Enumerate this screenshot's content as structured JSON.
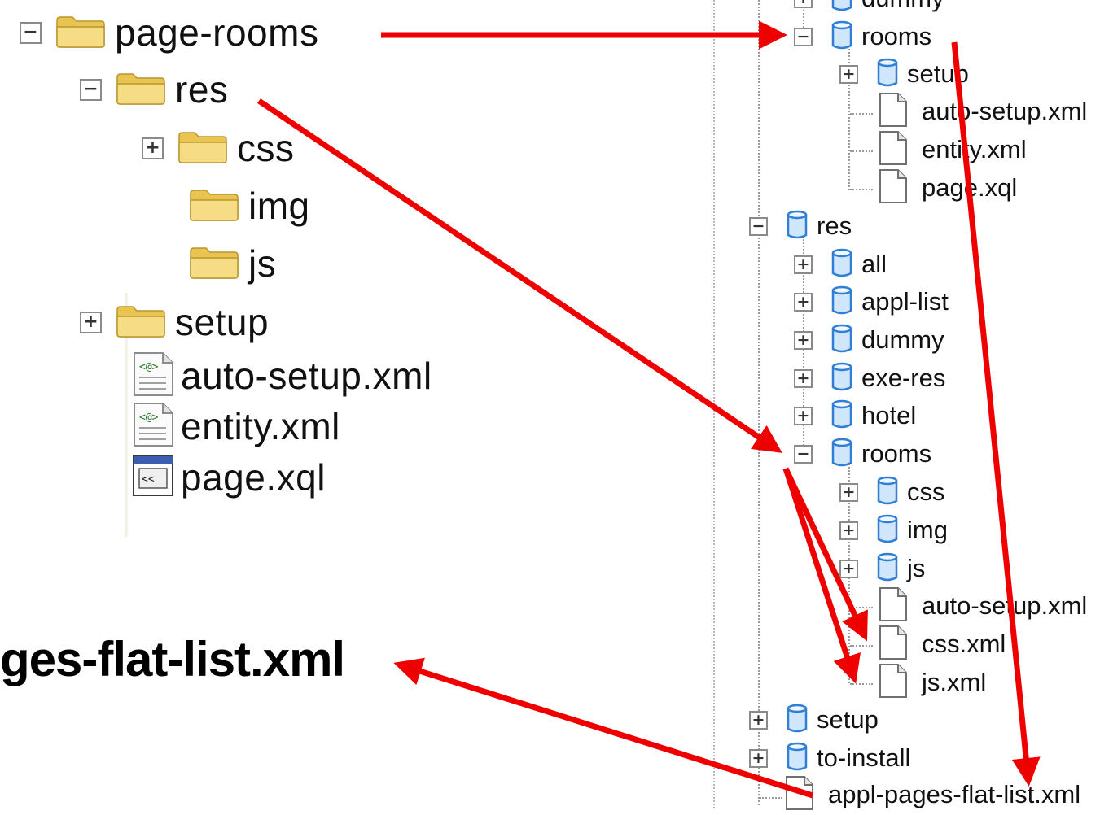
{
  "left_tree": {
    "items": [
      {
        "label": "page-rooms",
        "icon": "folder-icon",
        "expander": "minus"
      },
      {
        "label": "res",
        "icon": "folder-icon",
        "expander": "minus"
      },
      {
        "label": "css",
        "icon": "folder-icon",
        "expander": "plus"
      },
      {
        "label": "img",
        "icon": "folder-icon",
        "expander": ""
      },
      {
        "label": "js",
        "icon": "folder-icon",
        "expander": ""
      },
      {
        "label": "setup",
        "icon": "folder-icon",
        "expander": "plus"
      },
      {
        "label": "auto-setup.xml",
        "icon": "xml-file-icon",
        "expander": ""
      },
      {
        "label": "entity.xml",
        "icon": "xml-file-icon",
        "expander": ""
      },
      {
        "label": "page.xql",
        "icon": "xql-file-icon",
        "expander": ""
      }
    ]
  },
  "big_label": "ges-flat-list.xml",
  "right_tree": {
    "items": [
      {
        "label": "dummy",
        "icon": "collection-icon",
        "expander": "plus"
      },
      {
        "label": "rooms",
        "icon": "collection-icon",
        "expander": "minus"
      },
      {
        "label": "setup",
        "icon": "collection-icon",
        "expander": "plus"
      },
      {
        "label": "auto-setup.xml",
        "icon": "document-icon",
        "expander": ""
      },
      {
        "label": "entity.xml",
        "icon": "document-icon",
        "expander": ""
      },
      {
        "label": "page.xql",
        "icon": "document-icon",
        "expander": ""
      },
      {
        "label": "res",
        "icon": "collection-icon",
        "expander": "minus"
      },
      {
        "label": "all",
        "icon": "collection-icon",
        "expander": "plus"
      },
      {
        "label": "appl-list",
        "icon": "collection-icon",
        "expander": "plus"
      },
      {
        "label": "dummy",
        "icon": "collection-icon",
        "expander": "plus"
      },
      {
        "label": "exe-res",
        "icon": "collection-icon",
        "expander": "plus"
      },
      {
        "label": "hotel",
        "icon": "collection-icon",
        "expander": "plus"
      },
      {
        "label": "rooms",
        "icon": "collection-icon",
        "expander": "minus"
      },
      {
        "label": "css",
        "icon": "collection-icon",
        "expander": "plus"
      },
      {
        "label": "img",
        "icon": "collection-icon",
        "expander": "plus"
      },
      {
        "label": "js",
        "icon": "collection-icon",
        "expander": "plus"
      },
      {
        "label": "auto-setup.xml",
        "icon": "document-icon",
        "expander": ""
      },
      {
        "label": "css.xml",
        "icon": "document-icon",
        "expander": ""
      },
      {
        "label": "js.xml",
        "icon": "document-icon",
        "expander": ""
      },
      {
        "label": "setup",
        "icon": "collection-icon",
        "expander": "plus"
      },
      {
        "label": "to-install",
        "icon": "collection-icon",
        "expander": "plus"
      },
      {
        "label": "appl-pages-flat-list.xml",
        "icon": "document-icon",
        "expander": ""
      }
    ]
  },
  "colors": {
    "arrow": "#ee0000",
    "folder_fill": "#f6dd85",
    "collection_fill": "#cfe6fb",
    "collection_stroke": "#2f7fd6"
  }
}
